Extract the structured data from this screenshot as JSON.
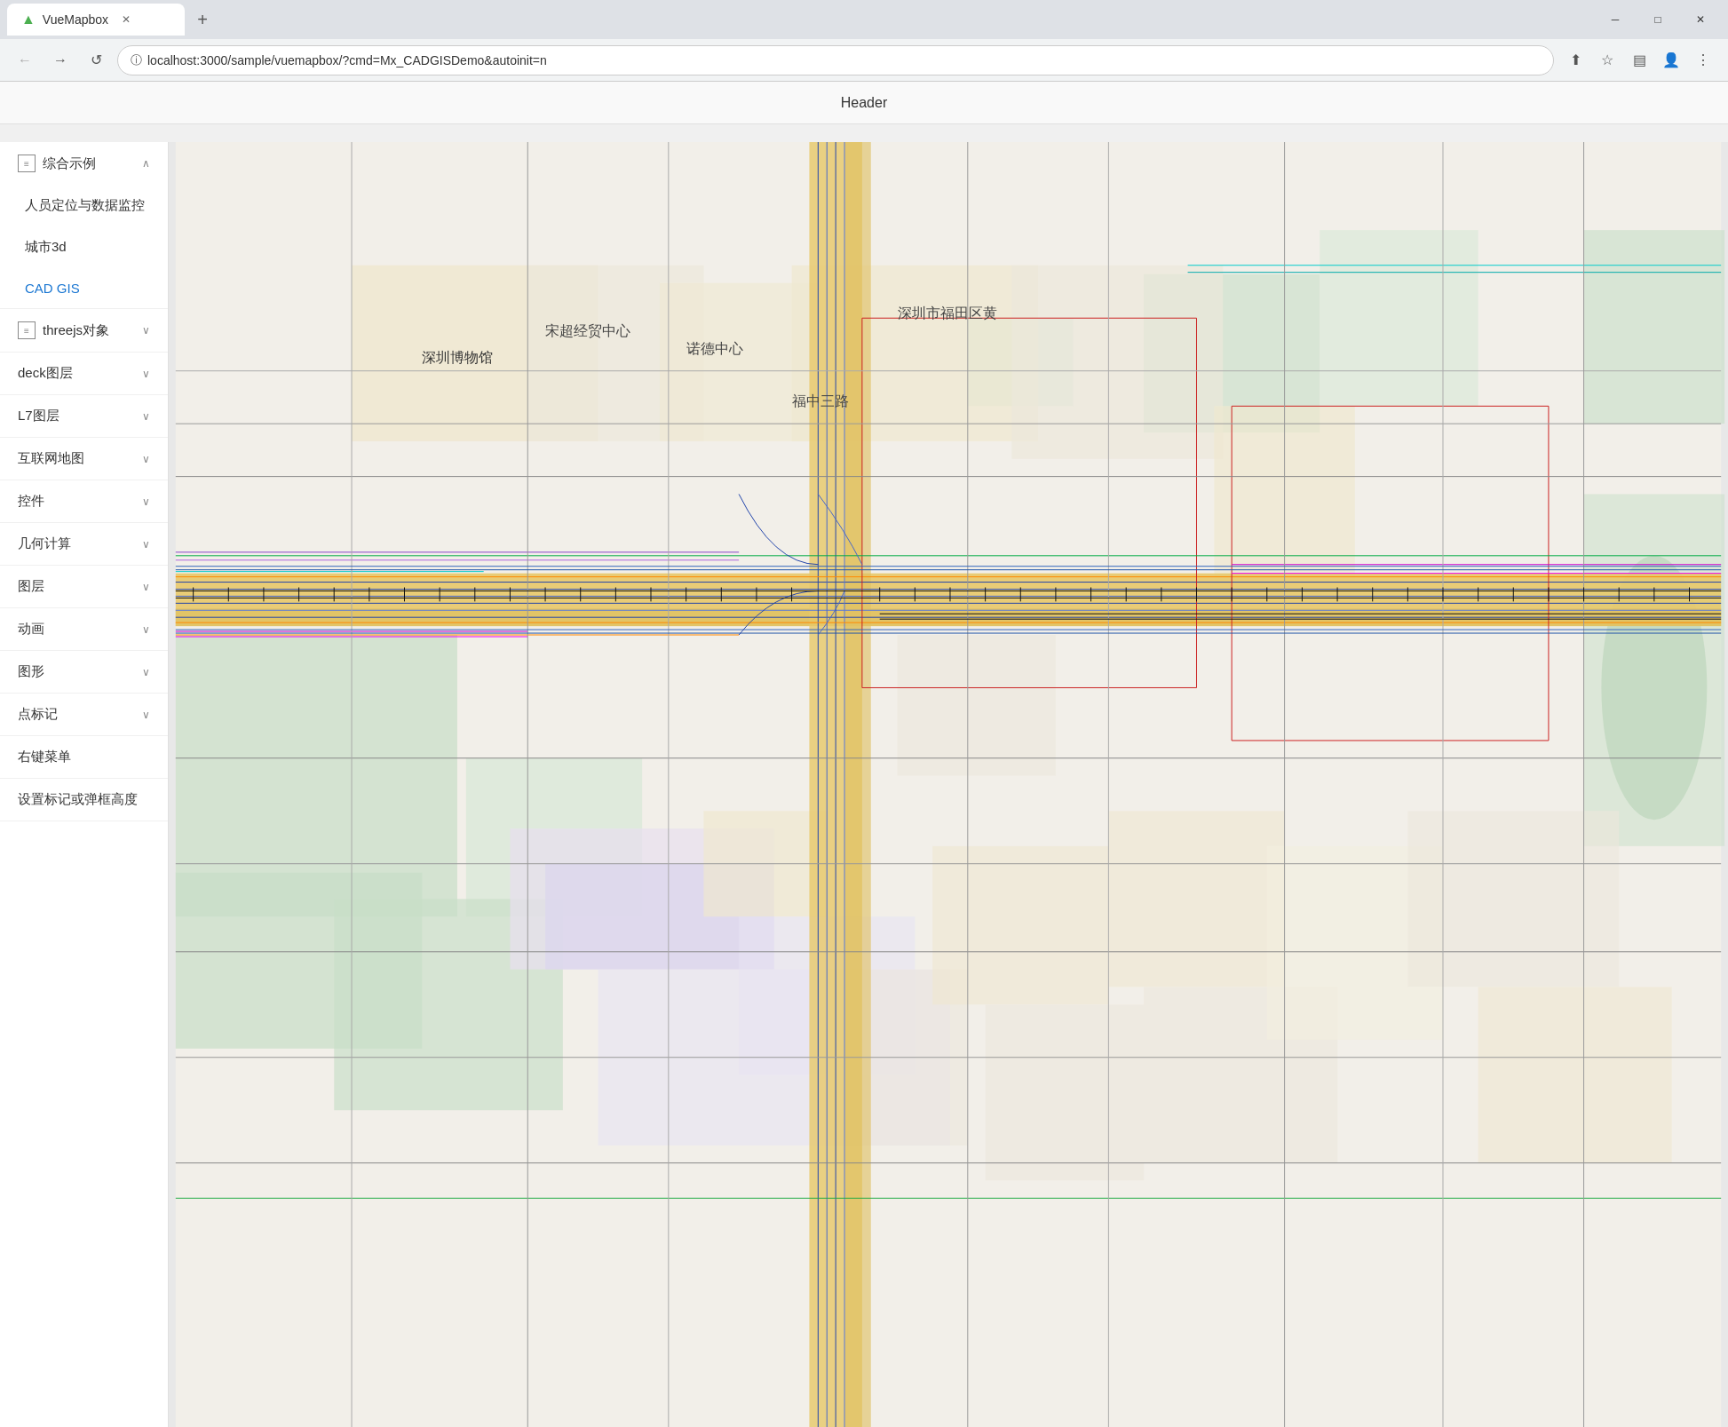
{
  "browser": {
    "tab_title": "VueMapbox",
    "tab_icon": "▲",
    "url": "localhost:3000/sample/vuemapbox/?cmd=Mx_CADGISDemo&autoinit=n",
    "window_controls": {
      "minimize": "─",
      "maximize": "□",
      "close": "✕"
    }
  },
  "page": {
    "header": "Header"
  },
  "sidebar": {
    "sections": [
      {
        "id": "comprehensive",
        "label": "综合示例",
        "has_icon": true,
        "expanded": true,
        "children": [
          {
            "id": "person-tracking",
            "label": "人员定位与数据监控"
          },
          {
            "id": "city-3d",
            "label": "城市3d"
          },
          {
            "id": "cad-gis",
            "label": "CAD GIS",
            "active": true
          }
        ]
      },
      {
        "id": "threejs",
        "label": "threejs对象",
        "has_icon": true,
        "expanded": false,
        "children": []
      },
      {
        "id": "deck",
        "label": "deck图层",
        "expanded": false,
        "children": []
      },
      {
        "id": "l7",
        "label": "L7图层",
        "expanded": false,
        "children": []
      },
      {
        "id": "internet-map",
        "label": "互联网地图",
        "expanded": false,
        "children": []
      },
      {
        "id": "controls",
        "label": "控件",
        "expanded": false,
        "children": []
      },
      {
        "id": "geometry-calc",
        "label": "几何计算",
        "expanded": false,
        "children": []
      },
      {
        "id": "layers",
        "label": "图层",
        "expanded": false,
        "children": []
      },
      {
        "id": "animation",
        "label": "动画",
        "expanded": false,
        "children": []
      },
      {
        "id": "graphics",
        "label": "图形",
        "expanded": false,
        "children": []
      },
      {
        "id": "markers",
        "label": "点标记",
        "expanded": false,
        "children": []
      },
      {
        "id": "context-menu",
        "label": "右键菜单",
        "expanded": false,
        "children": []
      },
      {
        "id": "marker-height",
        "label": "设置标记或弹框高度",
        "expanded": false,
        "children": []
      }
    ]
  },
  "toolbar": {
    "back_label": "←",
    "forward_label": "→",
    "refresh_label": "↺",
    "bookmark_label": "★",
    "profile_label": "👤",
    "menu_label": "⋮"
  }
}
